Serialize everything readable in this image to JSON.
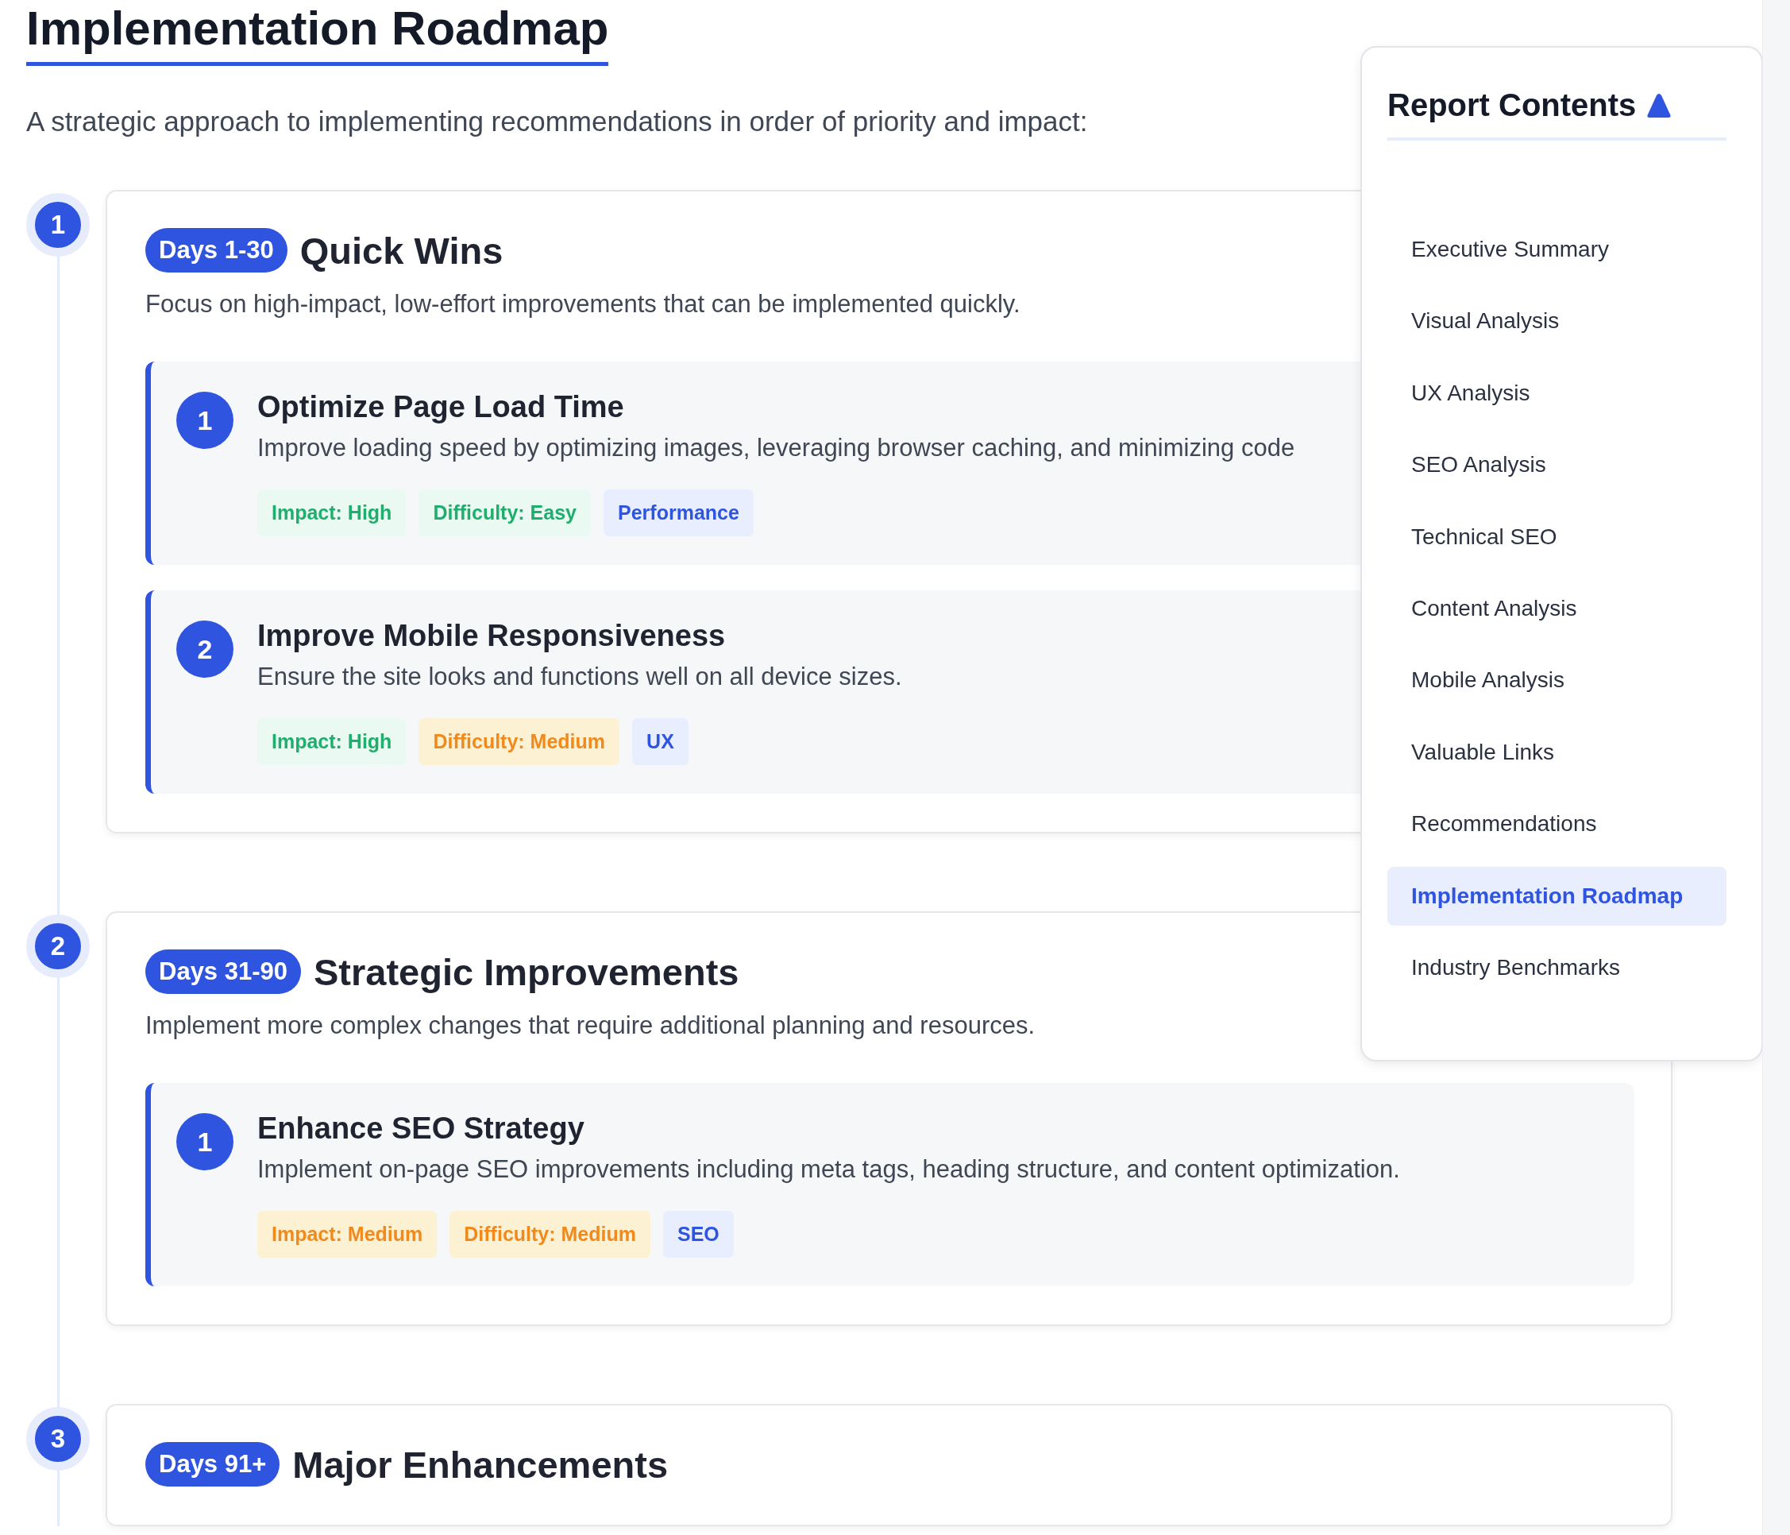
{
  "title": "Implementation Roadmap",
  "intro": "A strategic approach to implementing recommendations in order of priority and impact:",
  "phases": [
    {
      "number": "1",
      "days": "Days 1-30",
      "title": "Quick Wins",
      "description": "Focus on high-impact, low-effort improvements that can be implemented quickly.",
      "items": [
        {
          "number": "1",
          "title": "Optimize Page Load Time",
          "description": "Improve loading speed by optimizing images, leveraging browser caching, and minimizing code",
          "tags": [
            {
              "label": "Impact: High",
              "kind": "positive"
            },
            {
              "label": "Difficulty: Easy",
              "kind": "positive"
            },
            {
              "label": "Performance",
              "kind": "category"
            }
          ]
        },
        {
          "number": "2",
          "title": "Improve Mobile Responsiveness",
          "description": "Ensure the site looks and functions well on all device sizes.",
          "tags": [
            {
              "label": "Impact: High",
              "kind": "positive"
            },
            {
              "label": "Difficulty: Medium",
              "kind": "moderate"
            },
            {
              "label": "UX",
              "kind": "category"
            }
          ]
        }
      ]
    },
    {
      "number": "2",
      "days": "Days 31-90",
      "title": "Strategic Improvements",
      "description": "Implement more complex changes that require additional planning and resources.",
      "items": [
        {
          "number": "1",
          "title": "Enhance SEO Strategy",
          "description": "Implement on-page SEO improvements including meta tags, heading structure, and content optimization.",
          "tags": [
            {
              "label": "Impact: Medium",
              "kind": "moderate"
            },
            {
              "label": "Difficulty: Medium",
              "kind": "moderate"
            },
            {
              "label": "SEO",
              "kind": "category"
            }
          ]
        }
      ]
    },
    {
      "number": "3",
      "days": "Days 91+",
      "title": "Major Enhancements"
    }
  ],
  "contents": {
    "title": "Report Contents",
    "items": [
      {
        "label": "Executive Summary",
        "selected": false
      },
      {
        "label": "Visual Analysis",
        "selected": false
      },
      {
        "label": "UX Analysis",
        "selected": false
      },
      {
        "label": "SEO Analysis",
        "selected": false
      },
      {
        "label": "Technical SEO",
        "selected": false
      },
      {
        "label": "Content Analysis",
        "selected": false
      },
      {
        "label": "Mobile Analysis",
        "selected": false
      },
      {
        "label": "Valuable Links",
        "selected": false
      },
      {
        "label": "Recommendations",
        "selected": false
      },
      {
        "label": "Implementation Roadmap",
        "selected": true
      },
      {
        "label": "Industry Benchmarks",
        "selected": false
      }
    ]
  }
}
